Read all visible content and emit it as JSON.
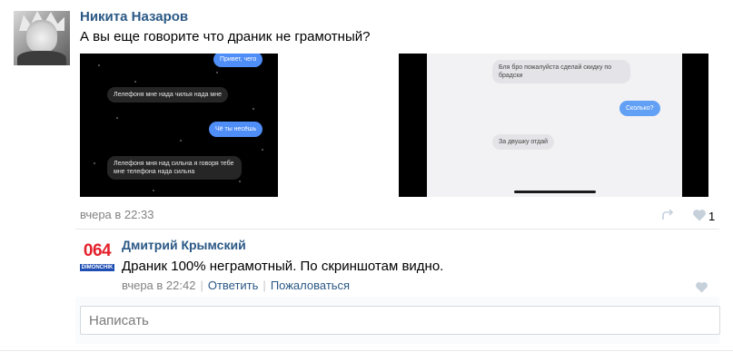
{
  "post": {
    "author": "Никита Назаров",
    "text": "А вы еще говорите что драник не грамотный?",
    "date": "вчера в 22:33",
    "like_count": "1",
    "photo1": {
      "messages": [
        {
          "text": "Привет, чего",
          "style": "blue"
        },
        {
          "text": "Лелефоня мне нада чилья нада мне",
          "style": "dark"
        },
        {
          "text": "Чё ты несёшь",
          "style": "blue"
        },
        {
          "text": "Лелефоня мня над сильна я говоря тебе мне телефона нада сильна",
          "style": "dark"
        }
      ]
    },
    "photo2": {
      "messages": [
        {
          "text": "Бля бро пожалуйста сделай скидку по брадски",
          "style": "light"
        },
        {
          "text": "Сколько?",
          "style": "blue"
        },
        {
          "text": "За двушку отдай",
          "style": "light"
        }
      ]
    }
  },
  "comment": {
    "avatar_number": "064",
    "avatar_tag": "DIMONCHIK",
    "author": "Дмитрий Крымский",
    "text": "Драник 100% неграмотный. По скриншотам видно.",
    "date": "вчера в 22:42",
    "reply_label": "Ответить",
    "report_label": "Пожаловаться"
  },
  "reply_box": {
    "placeholder": "Написать"
  },
  "colors": {
    "link": "#2a5885",
    "meta": "#828282",
    "bubble_blue": "#4f8df7",
    "avatar_red": "#e4202a",
    "avatar_blue": "#1f4fb4"
  }
}
